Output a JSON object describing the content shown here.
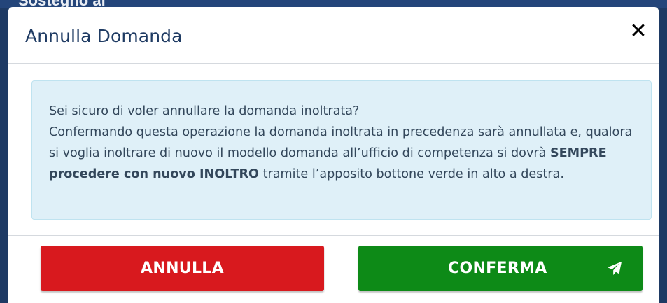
{
  "backdrop": {
    "partial_heading": "Sostegno al"
  },
  "modal": {
    "title": "Annulla Domanda",
    "close_label": "✕"
  },
  "message": {
    "line1": "Sei sicuro di voler annullare la domanda inoltrata?",
    "line2_before_bold": "Confermando questa operazione la domanda inoltrata in precedenza sarà annullata e, qualora si voglia inoltrare di nuovo il modello domanda all’ufficio di competenza si dovrà ",
    "line2_bold": "SEMPRE procedere con nuovo INOLTRO",
    "line2_after_bold": " tramite l’apposito bottone verde in alto a destra."
  },
  "footer": {
    "cancel_label": "ANNULLA",
    "confirm_label": "CONFERMA",
    "confirm_icon": "paper-plane-icon"
  },
  "colors": {
    "cancel_button": "#d8191e",
    "confirm_button": "#0d8a17",
    "alert_background": "#dff0f8",
    "title_text": "#1f3b63"
  }
}
